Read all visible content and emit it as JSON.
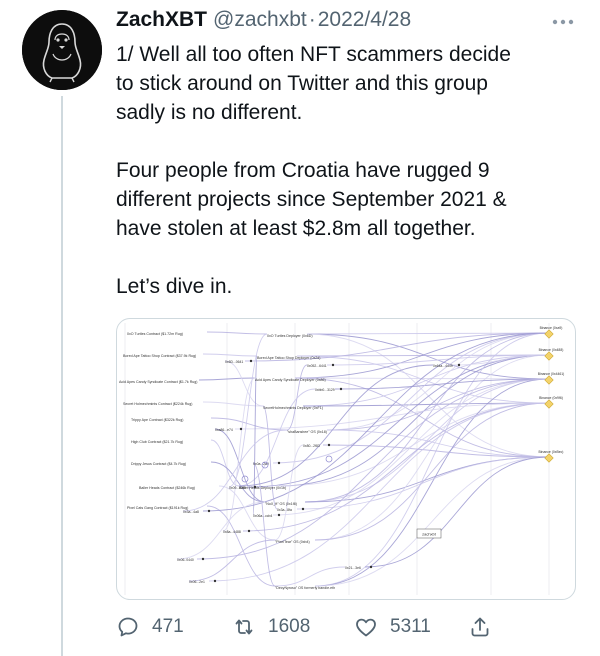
{
  "tweet": {
    "author": {
      "display_name": "ZachXBT",
      "handle": "@zachxbt",
      "separator": "·",
      "date": "2022/4/28",
      "avatar_icon": "penguin-avatar-icon"
    },
    "text": {
      "p1_lines": [
        "1/ Well all too often NFT scammers decide",
        "to stick around on Twitter and this group",
        "sadly is no different."
      ],
      "p2_lines": [
        "Four people from Croatia have rugged 9",
        "different projects since September 2021 &",
        "have stolen at least $2.8m all together."
      ],
      "p3_lines": [
        "Let’s dive in."
      ]
    },
    "media": {
      "type": "image",
      "description_icon": "network-graph-image",
      "left_nodes": [
        "0xO Turtles Contract ($1.72m Rug)",
        "Bored Ape Tattoo Shop Contract ($37.9k Rug)",
        "Acid Apes Candy Syndicate Contract ($1.7k Rug)",
        "Secret Holmechmints Contract ($224k Rug)",
        "Trippy Ape Contract ($322k Rug)",
        "High Club Contract ($21.7k Rug)",
        "Drippy Jesus Contract ($4.7k Rug)",
        "Baller Heads Contract ($246k Rug)",
        "Pixel Cats Gang Contract ($191k Rug)"
      ],
      "mid_nodes": [
        "0xO Turtles Deployer (0x6D)",
        "Bored Ape Tattoo Shop Deployer (0x2d)",
        "Acid Apes Candy Syndicate Deployer (0x86)",
        "SecretHolmechmints Deployer (0xF1)",
        "\"shaBanshee\" OS (0x18)",
        "Baller Heads Deployer (0x1b)",
        "\"NoX_ft\" OS (0x1f8)",
        "\"PixelTear\" OS (0xb4)",
        "\"DecyNyroso\" OS formerly bandie.eth"
      ],
      "right_nodes": [
        "Binance (0xa9)",
        "Binance (0x488)",
        "Binance (0x4461)",
        "Binance (0x9f6)",
        "Binance (0xBec)"
      ],
      "wallet_nodes": [
        "0x6D...0641",
        "0x052...6441",
        "0xbb0...3129",
        "0xa86...e74",
        "0x80...2f83",
        "0x0a...2a9",
        "0x09...d2f0",
        "0x06a...ccb4",
        "0x8a...4488",
        "0x3a...8fa",
        "0x3a...4a8",
        "0x64a...4449",
        "0x06..0440",
        "0x06...2e1",
        "0x21...3e6"
      ],
      "center_label": "zachxbt"
    },
    "actions": {
      "reply": {
        "icon": "reply-icon",
        "count": "471"
      },
      "retweet": {
        "icon": "retweet-icon",
        "count": "1608"
      },
      "like": {
        "icon": "heart-icon",
        "count": "5311"
      },
      "share": {
        "icon": "share-icon"
      },
      "more": {
        "icon": "more-dots-icon"
      }
    }
  }
}
